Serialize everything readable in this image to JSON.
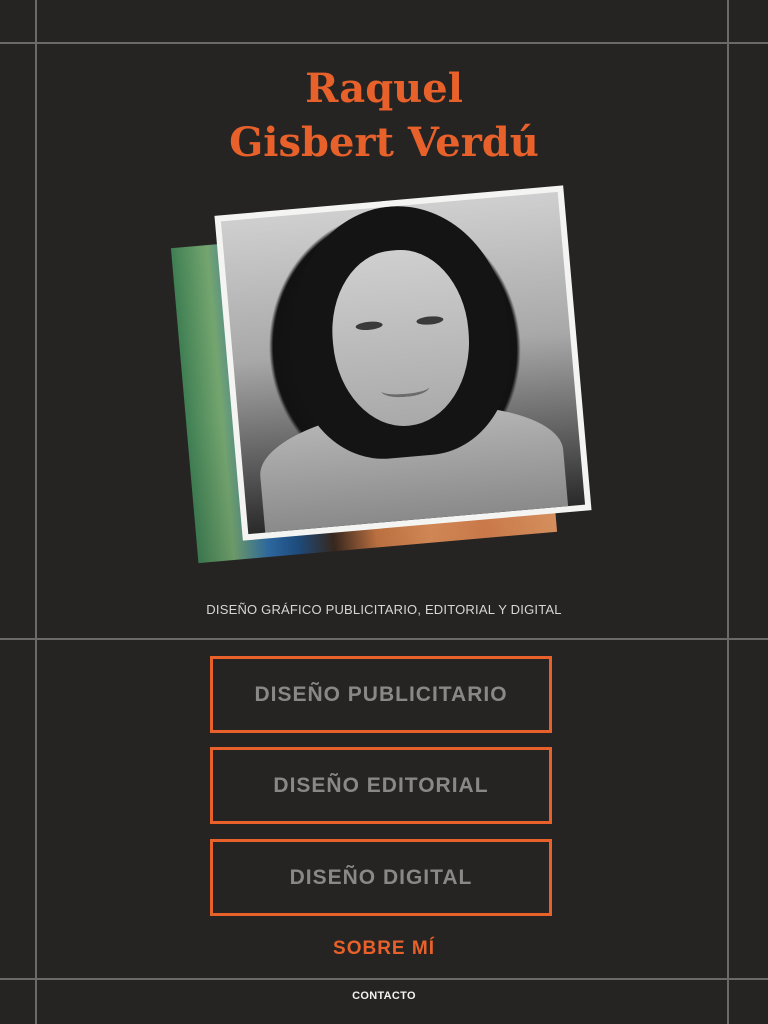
{
  "header": {
    "name_line1": "Raquel",
    "name_line2": "Gisbert Verdú"
  },
  "tagline": "DISEÑO GRÁFICO PUBLICITARIO, EDITORIAL Y DIGITAL",
  "nav": {
    "buttons": [
      {
        "label": "DISEÑO PUBLICITARIO"
      },
      {
        "label": "DISEÑO EDITORIAL"
      },
      {
        "label": "DISEÑO DIGITAL"
      }
    ],
    "about_label": "SOBRE MÍ",
    "contact_label": "CONTACTO"
  },
  "colors": {
    "background": "#262423",
    "accent": "#e8612a",
    "guide_lines": "#6b6a69",
    "button_text": "#8a8886"
  }
}
